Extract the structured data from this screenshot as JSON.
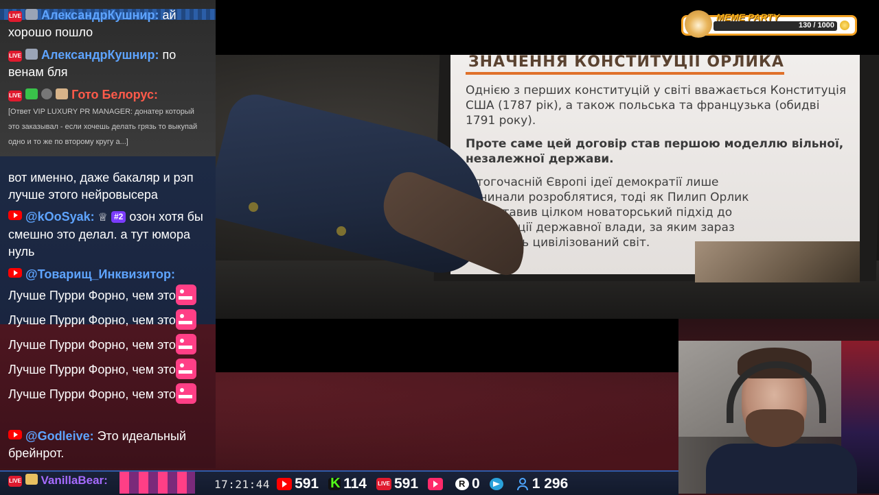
{
  "video": {
    "slide_title": "ЗНАЧЕННЯ КОНСТИТУЦІЇ ОРЛИКА",
    "paragraphs": [
      "Однією з перших конституцій у світі вважається Конституція США (1787 рік), а також польська та французька (обидві 1791 року).",
      "Проте саме цей договір став першою моделлю вільної, незалежної держави.",
      "У тогочасній Європі ідеї демократії лише починали розроблятися, тоді як Пилип Орлик представив цілком новаторський підхід до організації державної влади, за яким зараз живе весь цивілізований світ."
    ]
  },
  "chat": {
    "messages": [
      {
        "author": "АлександрКушнир:",
        "text": "ай хорошо пошло"
      },
      {
        "author": "АлександрКушнир:",
        "text": "по венам бля"
      },
      {
        "author": "Гото Белорус:",
        "text": "[Ответ VIP LUXURY PR MANAGER: донатер который это заказывал - если хочешь делать грязь то выкупай одно и то же по второму кругу а...]"
      },
      {
        "text": "вот именно, даже бакаляр и рэп лучше этого нейровысера"
      },
      {
        "author": "@kOoSyak:",
        "rank": "#2",
        "text": "озон хотя бы смешно это делал. а тут юмора нуль"
      },
      {
        "author": "@Товарищ_Инквизитор:",
        "text_parts": [
          "Лучше Пурри Форно, чем это",
          "Лучше Пурри Форно, чем это",
          "Лучше Пурри Форно, чем это",
          "Лучше Пурри Форно, чем это",
          "Лучше Пурри Форно, чем это"
        ]
      },
      {
        "author": "@Godleive:",
        "text": "Это идеальный брейнрот."
      },
      {
        "author": "VanillaBear:"
      }
    ]
  },
  "meme_party": {
    "title": "MEME PARTY",
    "progress": "130 / 1000"
  },
  "bottom_bar": {
    "time": "17:21:44",
    "youtube": "591",
    "kick": "114",
    "live": "591",
    "play": "",
    "rutube": "0",
    "telegram": "",
    "viewers": "1 296"
  }
}
